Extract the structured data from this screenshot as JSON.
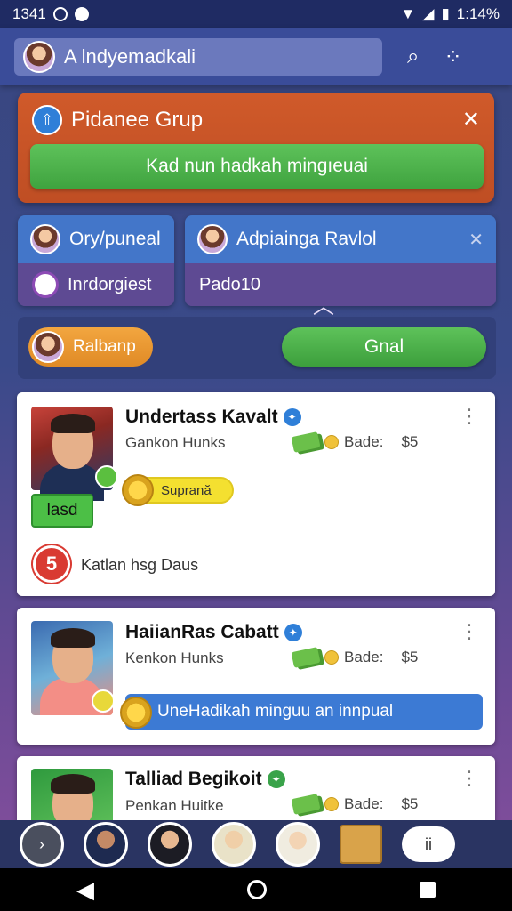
{
  "status": {
    "time": "1341",
    "battery": "1:14%"
  },
  "topbar": {
    "title": "A lndyemadkali"
  },
  "group": {
    "title": "Pidanee Grup",
    "button_label": "Kad nun hadkah mingıeuai"
  },
  "cards": {
    "left": {
      "name": "Ory/puneal",
      "sub": "Inrdorgiest"
    },
    "right": {
      "name": "Adpiainga Ravlol",
      "sub": "Pado10"
    }
  },
  "actions": {
    "orange_label": "Ralbanp",
    "green_label": "Gnal"
  },
  "feed": [
    {
      "name": "Undertass Kavalt",
      "sub": "Gankon Hunks",
      "badge_label": "Bade:",
      "badge_value": "$5",
      "pill": "Suprană",
      "tag": "lasd",
      "footer_icon_text": "5",
      "footer": "Katlan hsg Daus"
    },
    {
      "name": "HaiianRas Cabatt",
      "sub": "Kenkon Hunks",
      "badge_label": "Bade:",
      "badge_value": "$5",
      "pill": "UneHadikah minguu an innpual"
    },
    {
      "name": "Talliad Begikoit",
      "sub": "Penkan Huitke",
      "badge_label": "Bade:",
      "badge_value": "$5"
    }
  ],
  "dock": {
    "pause_label": "ii"
  },
  "colors": {
    "accent_orange": "#d05a2a",
    "accent_green": "#4cbf46",
    "accent_blue": "#3c7ad4",
    "bg": "#3a4a8a"
  }
}
